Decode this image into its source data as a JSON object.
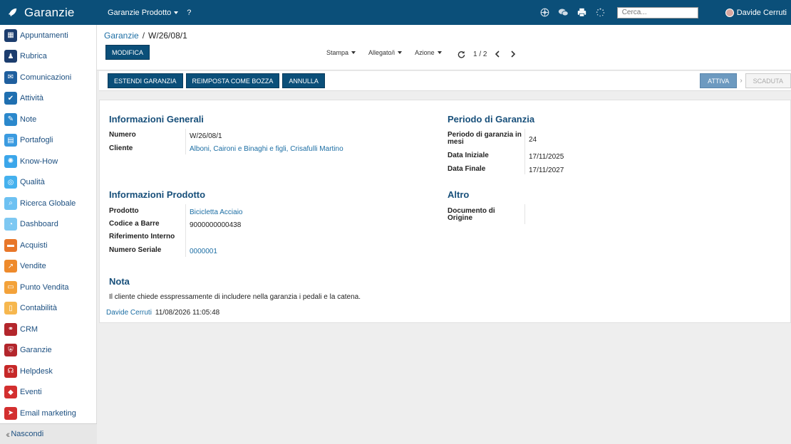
{
  "app": {
    "title": "Garanzie",
    "menu_label": "Garanzie Prodotto",
    "help": "?"
  },
  "topbar": {
    "icons": [
      "settings-wheel-icon",
      "chat-icon",
      "print-icon",
      "activity-spinner-icon"
    ],
    "search_placeholder": "Cerca...",
    "user_name": "Davide Cerruti"
  },
  "sidebar": {
    "items": [
      {
        "label": "Appuntamenti",
        "icon": "calendar-icon",
        "color": "#1c3d6e"
      },
      {
        "label": "Rubrica",
        "icon": "contacts-icon",
        "color": "#1c3d6e"
      },
      {
        "label": "Comunicazioni",
        "icon": "message-icon",
        "color": "#1f5f9e"
      },
      {
        "label": "Attività",
        "icon": "check-icon",
        "color": "#1f6fb0"
      },
      {
        "label": "Note",
        "icon": "note-icon",
        "color": "#2b88cc"
      },
      {
        "label": "Portafogli",
        "icon": "wallet-icon",
        "color": "#3b9be0"
      },
      {
        "label": "Know-How",
        "icon": "brain-icon",
        "color": "#3ba6ea"
      },
      {
        "label": "Qualità",
        "icon": "quality-icon",
        "color": "#45b1ee"
      },
      {
        "label": "Ricerca Globale",
        "icon": "search-icon",
        "color": "#6dc1f2"
      },
      {
        "label": "Dashboard",
        "icon": "dashboard-icon",
        "color": "#7ec8f2"
      },
      {
        "label": "Acquisti",
        "icon": "purchase-icon",
        "color": "#e8772a"
      },
      {
        "label": "Vendite",
        "icon": "sales-icon",
        "color": "#ee8a2c"
      },
      {
        "label": "Punto Vendita",
        "icon": "pos-icon",
        "color": "#f3a23a"
      },
      {
        "label": "Contabilità",
        "icon": "accounting-icon",
        "color": "#f6b74e"
      },
      {
        "label": "CRM",
        "icon": "crm-icon",
        "color": "#b3262c"
      },
      {
        "label": "Garanzie",
        "icon": "shield-icon",
        "color": "#b3262c"
      },
      {
        "label": "Helpdesk",
        "icon": "headset-icon",
        "color": "#c62828"
      },
      {
        "label": "Eventi",
        "icon": "ticket-icon",
        "color": "#d32f2f"
      },
      {
        "label": "Email marketing",
        "icon": "send-icon",
        "color": "#d32f2f"
      }
    ],
    "footer_label": "Nascondi"
  },
  "breadcrumb": {
    "parent": "Garanzie",
    "current": "W/26/08/1"
  },
  "toolbar": {
    "edit_label": "MODIFICA",
    "print_label": "Stampa",
    "attach_label": "Allegato/i",
    "action_label": "Azione",
    "pager_value": "1 / 2"
  },
  "statusbar": {
    "buttons": [
      "ESTENDI GARANZIA",
      "REIMPOSTA COME BOZZA",
      "ANNULLA"
    ],
    "states": [
      {
        "label": "ATTIVA",
        "active": true
      },
      {
        "label": "SCADUTA",
        "active": false
      }
    ]
  },
  "form": {
    "general": {
      "title": "Informazioni Generali",
      "numero_label": "Numero",
      "numero_value": "W/26/08/1",
      "cliente_label": "Cliente",
      "cliente_value": "Alboni, Caironi e Binaghi e figli, Crisafulli Martino"
    },
    "period": {
      "title": "Periodo di Garanzia",
      "mesi_label_1": "Periodo di garanzia in",
      "mesi_label_2": "mesi",
      "mesi_value": "24",
      "start_label": "Data Iniziale",
      "start_value": "17/11/2025",
      "end_label": "Data Finale",
      "end_value": "17/11/2027"
    },
    "product": {
      "title": "Informazioni Prodotto",
      "prodotto_label": "Prodotto",
      "prodotto_value": "Bicicletta Acciaio",
      "barcode_label": "Codice a Barre",
      "barcode_value": "9000000000438",
      "ref_label": "Riferimento Interno",
      "ref_value": "",
      "serial_label": "Numero Seriale",
      "serial_value": "0000001"
    },
    "other": {
      "title": "Altro",
      "origin_label_1": "Documento di",
      "origin_label_2": "Origine",
      "origin_value": ""
    },
    "note": {
      "title": "Nota",
      "text": "Il cliente chiede esspressamente di includere nella garanzia i pedali e la catena.",
      "author": "Davide Cerruti",
      "timestamp": "11/08/2026 11:05:48"
    }
  }
}
